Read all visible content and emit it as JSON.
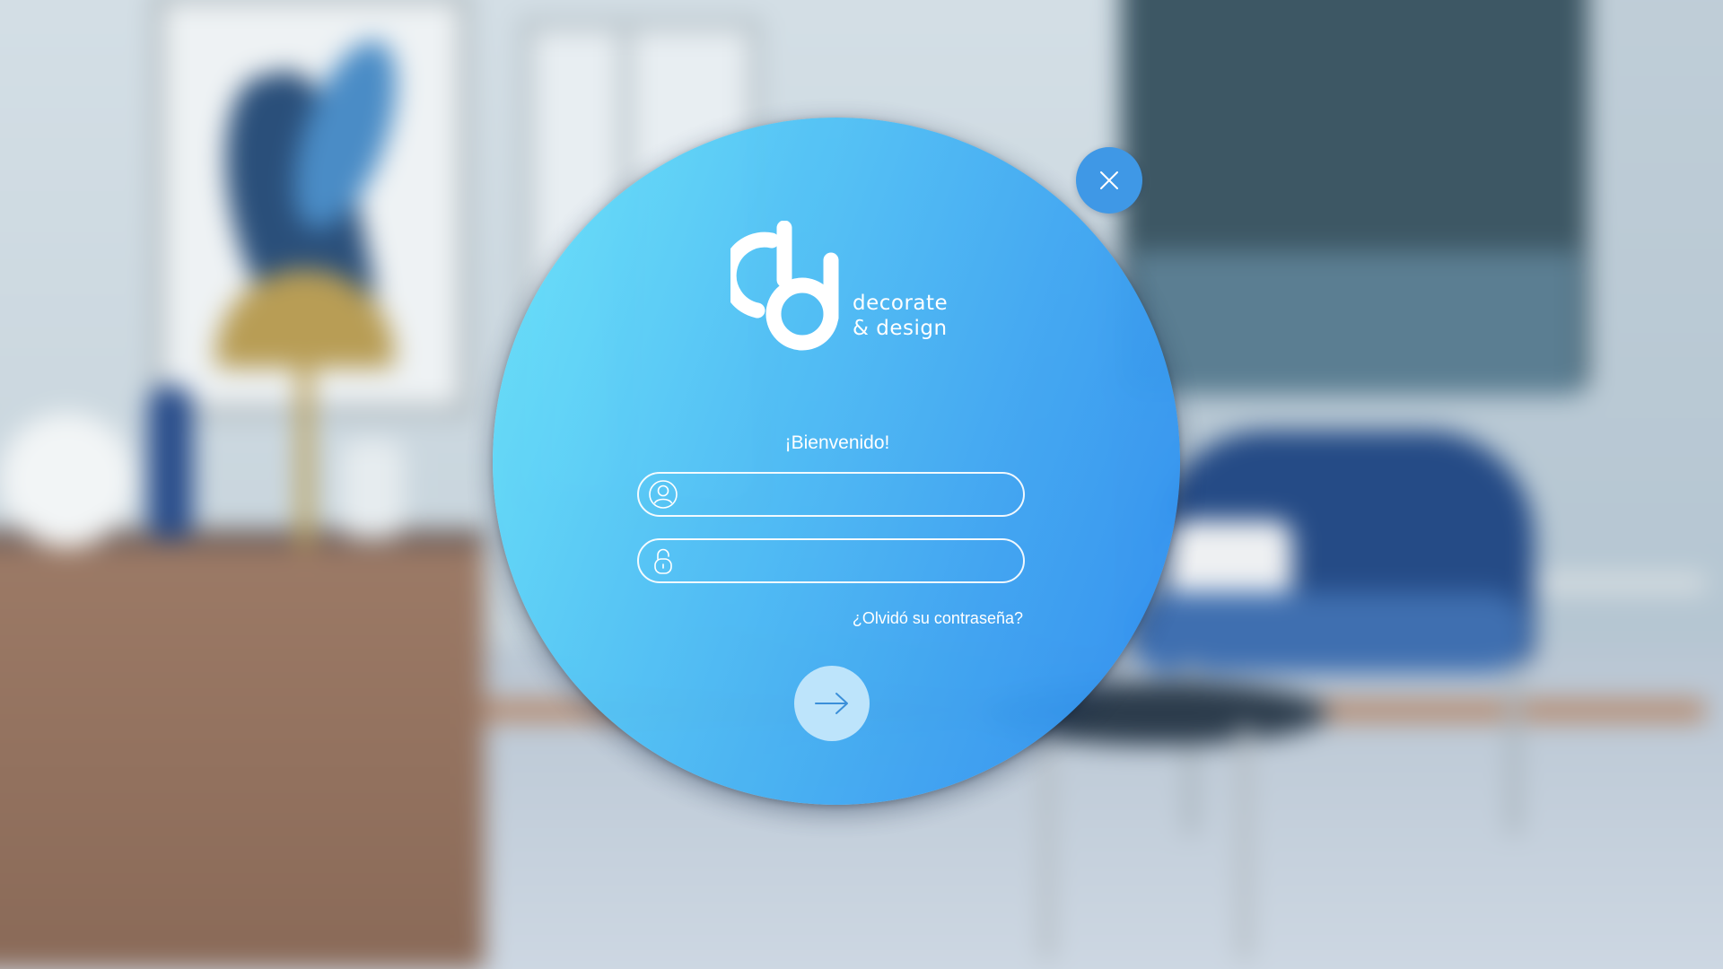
{
  "brand": {
    "logo_line1": "decorate",
    "logo_line2": "& design"
  },
  "login": {
    "welcome": "¡Bienvenido!",
    "username_value": "",
    "password_value": "",
    "forgot_password": "¿Olvidó su contraseña?"
  },
  "icons": {
    "close": "close-icon",
    "user": "user-icon",
    "lock": "lock-icon",
    "submit": "arrow-right-icon"
  },
  "colors": {
    "circle_start": "#69e4fa",
    "circle_end": "#2f8df0",
    "close_button": "#3f98e6",
    "submit_button": "#bde4fb",
    "text": "#ffffff"
  }
}
